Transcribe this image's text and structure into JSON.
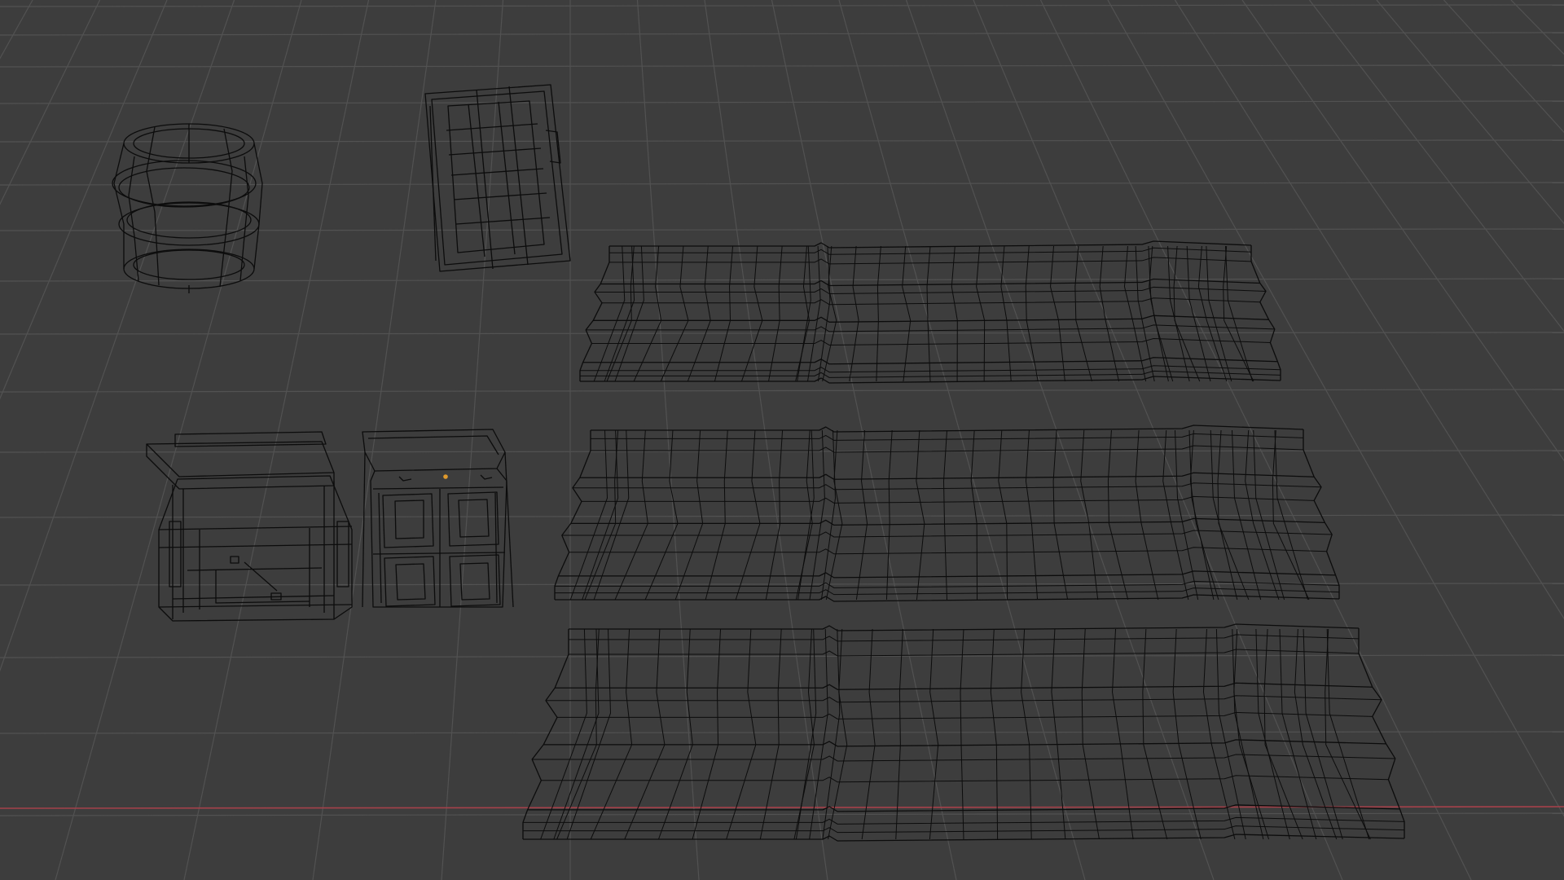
{
  "app": {
    "view": "3d-viewport",
    "shading": "wireframe"
  },
  "colors": {
    "background": "#3d3d3d",
    "grid_line": "#525252",
    "wire": "#0c0c0c",
    "x_axis": "#a5414a",
    "origin_point": "#e09a2c"
  },
  "scene": {
    "objects": [
      {
        "name": "barrel",
        "kind": "cylinder-mesh"
      },
      {
        "name": "lid-crate",
        "kind": "panel-mesh"
      },
      {
        "name": "chest-open",
        "kind": "box-mesh"
      },
      {
        "name": "chest-selected",
        "kind": "box-mesh",
        "selected": true
      },
      {
        "name": "wall-strip-1",
        "kind": "strip-mesh"
      },
      {
        "name": "wall-strip-2",
        "kind": "strip-mesh"
      },
      {
        "name": "wall-strip-3",
        "kind": "strip-mesh"
      }
    ]
  }
}
